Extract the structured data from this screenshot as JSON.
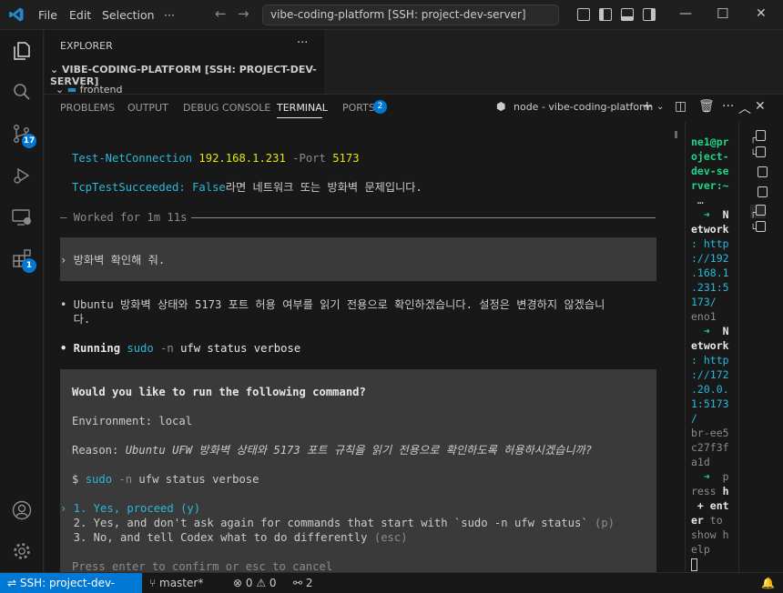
{
  "titlebar": {
    "menu": [
      "File",
      "Edit",
      "Selection",
      "···"
    ],
    "search_text": "vibe-coding-platform [SSH: project-dev-server]"
  },
  "activity": {
    "scm_badge": "17",
    "extensions_badge": "1"
  },
  "explorer": {
    "title": "EXPLORER",
    "more": "···",
    "root": "VIBE-CODING-PLATFORM [SSH: PROJECT-DEV-SERVER]",
    "child": "frontend"
  },
  "panel": {
    "tabs": [
      "PROBLEMS",
      "OUTPUT",
      "DEBUG CONSOLE",
      "TERMINAL",
      "PORTS"
    ],
    "ports_badge": "2",
    "terminal_name": "node - vibe-coding-platform"
  },
  "terminal": {
    "cmd_prefix": "Test-NetConnection ",
    "cmd_ip": "192.168.1.231",
    "cmd_flag": " -Port ",
    "cmd_port": "5173",
    "tcp_key": "TcpTestSucceeded: ",
    "tcp_val": "False",
    "tcp_msg": "라면 네트워크 또는 방화벽 문제입니다.",
    "worked": "— Worked for 1m 11s",
    "user_prompt": "› 방화벽 확인해 줘.",
    "assistant_1": "• Ubuntu 방화벽 상태와 5173 포트 허용 여부를 읽기 전용으로 확인하겠습니다. 설정은 변경하지 않겠습니",
    "assistant_1b": "  다.",
    "running_label": "• Running ",
    "running_cmd": "sudo",
    "running_flag": " -n",
    "running_rest": " ufw status verbose",
    "question": "Would you like to run the following command?",
    "env": "Environment: local",
    "reason_label": "Reason: ",
    "reason_text": "Ubuntu UFW 방화벽 상태와 5173 포트 규칙을 읽기 전용으로 확인하도록 허용하시겠습니까?",
    "dollar": "$ ",
    "cmd2": "sudo",
    "cmd2_flag": " -n",
    "cmd2_rest": " ufw status verbose",
    "opt1": "› 1. Yes, proceed (y)",
    "opt2": "  2. Yes, and don't ask again for commands that start with `sudo -n ufw status` ",
    "opt2_key": "(p)",
    "opt3": "  3. No, and tell Codex what to do differently ",
    "opt3_key": "(esc)",
    "footer": "Press enter to confirm or esc to cancel"
  },
  "side_terminal": {
    "lines": [
      "ne1@pr",
      "oject-",
      "dev-se",
      "rver:~",
      " …",
      "  ➜  N",
      "etwork",
      ": http",
      "://192",
      ".168.1",
      ".231:5",
      "173/",
      "eno1",
      "  ➜  N",
      "etwork",
      ": http",
      "://172",
      ".20.0.",
      "1:5173",
      "/",
      "br-ee5",
      "c27f3f",
      "a1d",
      "  ➜  p",
      "ress h",
      " + ent",
      "er to",
      "show h",
      "elp"
    ]
  },
  "statusbar": {
    "remote": "SSH: project-dev-server",
    "branch": "master*",
    "errors": "0",
    "warnings": "0",
    "ports": "2"
  }
}
